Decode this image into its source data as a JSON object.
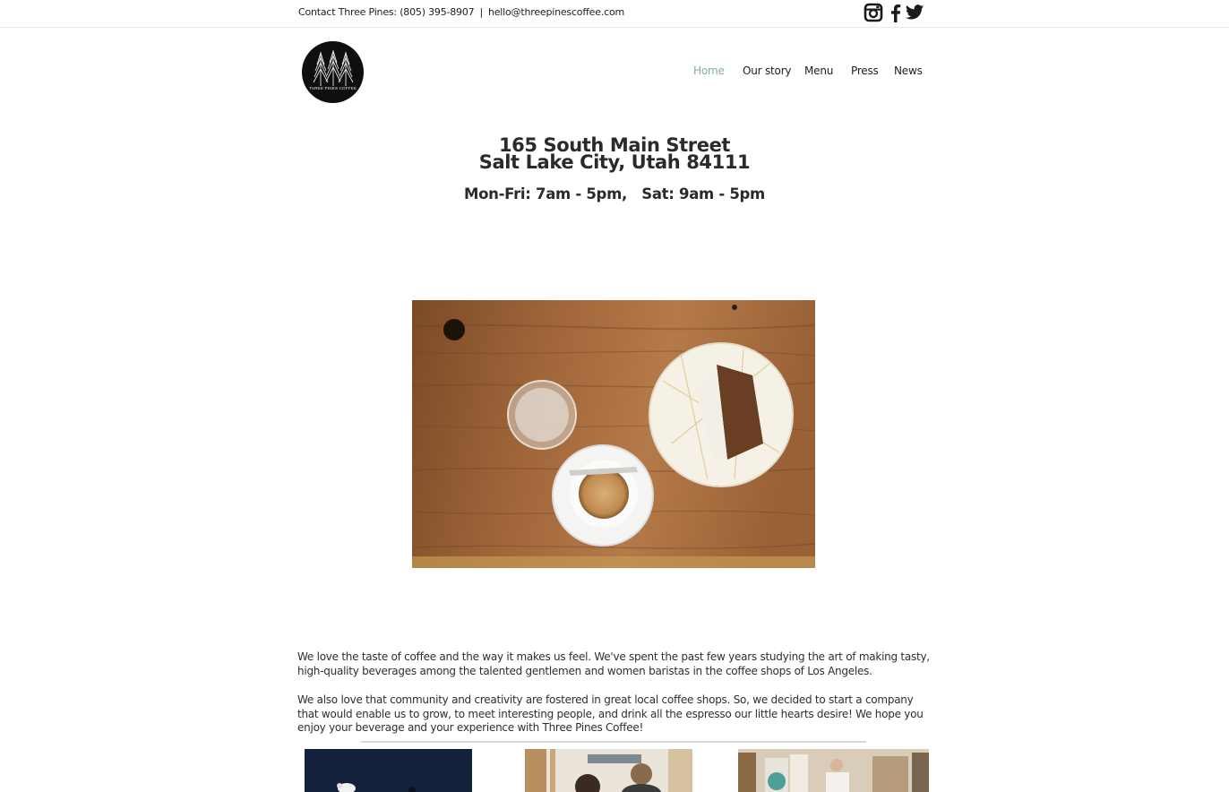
{
  "topbar": {
    "contact_label": "Contact Three Pines: (805) 395-8907",
    "separator": "|",
    "email": "hello@threepinescoffee.com",
    "social": [
      {
        "icon": "instagram-icon"
      },
      {
        "icon": "facebook-icon"
      },
      {
        "icon": "twitter-icon"
      }
    ]
  },
  "brand": {
    "logo_text": "THREE PINES COFFEE",
    "logo_icon": "three-pine-trees-icon"
  },
  "nav": {
    "items": [
      {
        "label": "Home",
        "active": true
      },
      {
        "label": "Our story",
        "active": false
      },
      {
        "label": "Menu",
        "active": false
      },
      {
        "label": "Press",
        "active": false
      },
      {
        "label": "News",
        "active": false
      }
    ],
    "active_color": "#7fb291"
  },
  "location": {
    "street": "165 South Main Street",
    "city": "Salt Lake City, Utah 84111",
    "hours": "Mon-Fri: 7am - 5pm,   Sat: 9am - 5pm"
  },
  "hero_image": {
    "subject": "espresso cup, glass of water and slice of cake on wooden table"
  },
  "about": {
    "paragraph_1": "We love the taste of coffee and the way it makes us feel. We've spent the past few years studying the art of making tasty, high-quality beverages among the talented gentlemen and women baristas in the coffee shops of Los Angeles.",
    "paragraph_2": "We also love that community and creativity are fostered in great local coffee shops. So, we decided to start a company that would enable us to grow, to meet interesting people, and drink all the espresso our little hearts desire! We hope you enjoy your beverage and your experience with Three Pines Coffee!"
  },
  "gallery": {
    "thumbnails": [
      {
        "subject": "dark blue photo"
      },
      {
        "subject": "barista at counter"
      },
      {
        "subject": "coffee bags on shelf"
      }
    ]
  }
}
